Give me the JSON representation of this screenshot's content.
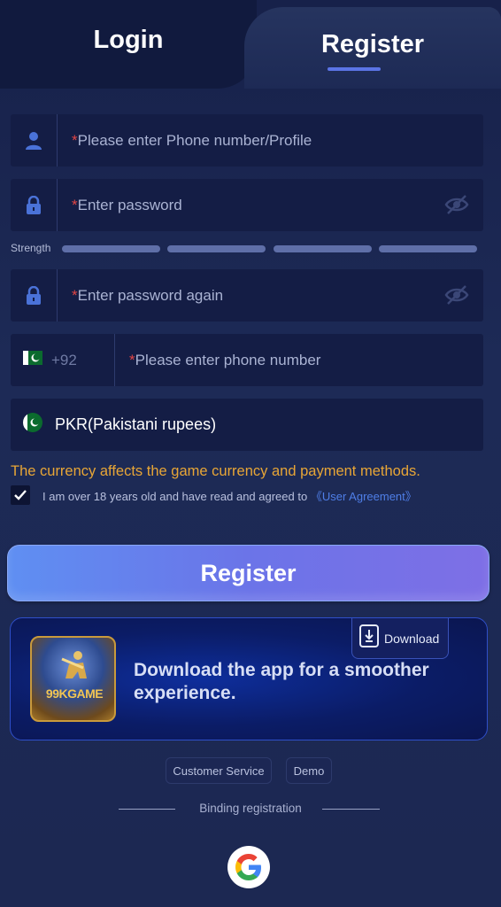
{
  "tabs": {
    "login_label": "Login",
    "register_label": "Register",
    "active": "register"
  },
  "form": {
    "phone_profile": {
      "required_mark": "*",
      "placeholder": "Please enter Phone number/Profile"
    },
    "password": {
      "required_mark": "*",
      "placeholder": "Enter password"
    },
    "strength_label": "Strength",
    "password_again": {
      "required_mark": "*",
      "placeholder": "Enter password again"
    },
    "phone": {
      "country_code": "+92",
      "required_mark": "*",
      "placeholder": "Please enter phone number"
    },
    "currency": {
      "value": "PKR(Pakistani rupees)"
    },
    "currency_note": "The currency affects the game currency and payment methods.",
    "agreement": {
      "checked": true,
      "text": "I am over 18 years old and have read and agreed to",
      "link": "《User Agreement》"
    }
  },
  "register_button": "Register",
  "download_card": {
    "thumb_label": "99KGAME",
    "message": "Download the app for a smoother experience.",
    "button_label": "Download"
  },
  "footer": {
    "customer_service": "Customer Service",
    "demo": "Demo",
    "binding_registration": "Binding registration"
  },
  "icons": {
    "user": "user-icon",
    "lock": "lock-icon",
    "eye_off": "eye-off-icon",
    "flag": "pakistan-flag-icon",
    "check": "check-icon",
    "download": "download-phone-icon",
    "google": "google-icon"
  },
  "colors": {
    "accent": "#5b74e6",
    "required": "#e24545",
    "warning": "#e8a636",
    "link": "#4f7fe8"
  }
}
